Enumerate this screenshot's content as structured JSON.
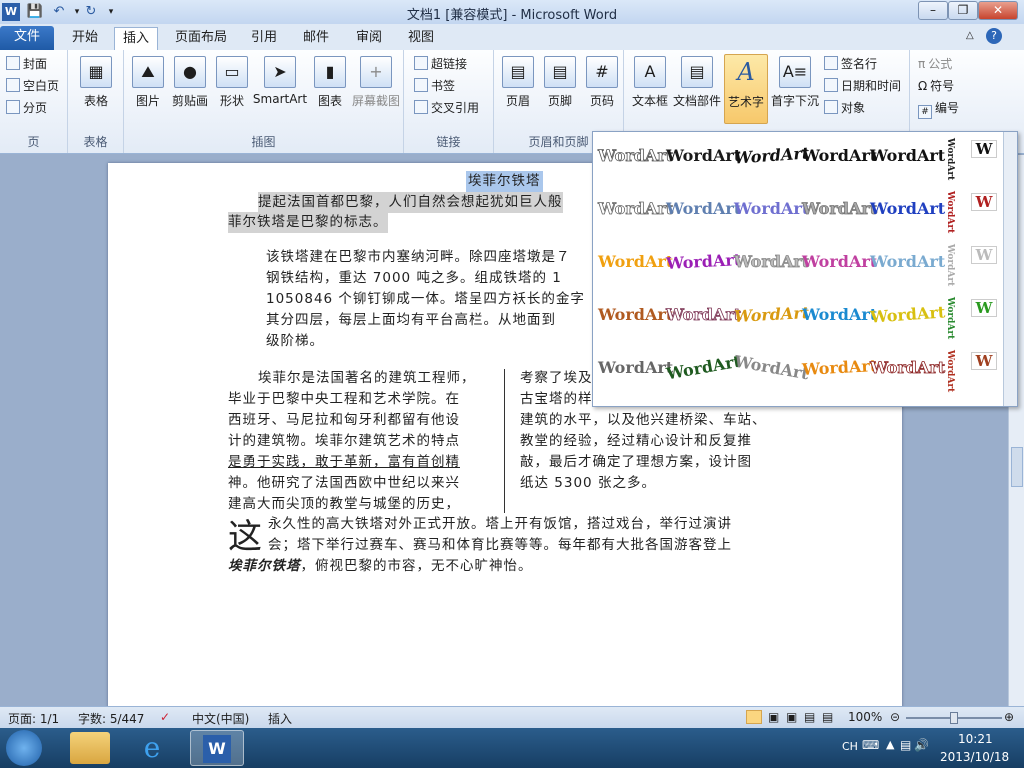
{
  "window": {
    "title": "文档1 [兼容模式] - Microsoft Word"
  },
  "tabs": [
    "文件",
    "开始",
    "插入",
    "页面布局",
    "引用",
    "邮件",
    "审阅",
    "视图"
  ],
  "ribbon": {
    "page": {
      "group": "页",
      "items": [
        "封面",
        "空白页",
        "分页"
      ]
    },
    "table": {
      "group": "表格",
      "label": "表格"
    },
    "illus": {
      "group": "插图",
      "items": [
        "图片",
        "剪贴画",
        "形状",
        "SmartArt",
        "图表",
        "屏幕截图"
      ]
    },
    "links": {
      "group": "链接",
      "items": [
        "超链接",
        "书签",
        "交叉引用"
      ]
    },
    "hf": {
      "group": "页眉和页脚",
      "items": [
        "页眉",
        "页脚",
        "页码"
      ]
    },
    "text": {
      "items": [
        "文本框",
        "文档部件",
        "艺术字",
        "首字下沉"
      ],
      "small": [
        "签名行",
        "日期和时间",
        "对象"
      ]
    },
    "symbols": {
      "items": [
        "公式",
        "符号",
        "编号"
      ]
    }
  },
  "wordart": {
    "sample": "WordArt",
    "vertical": "WordArt"
  },
  "document": {
    "title": "埃菲尔铁塔",
    "para1a": "提起法国首都巴黎，人们自然会想起犹如巨人般",
    "para1b": "菲尔铁塔是巴黎的标志。",
    "para2": [
      "该铁塔建在巴黎市内塞纳河畔。除四座塔墩是７",
      "钢铁结构，重达 7000 吨之多。组成铁塔的 1",
      "1050846 个铆钉铆成一体。塔呈四方袄长的金字",
      "其分四层，每层上面均有平台高栏。从地面到",
      "级阶梯。"
    ],
    "colLeft": [
      "埃菲尔是法国著名的建筑工程师，",
      "毕业于巴黎中央工程和艺术学院。在",
      "西班牙、马尼拉和匈牙利都留有他设",
      "计的建筑物。埃菲尔建筑艺术的特点",
      "是勇于实践，敢于革新，富有首创精",
      "神。他研究了法国西欧中世纪以来兴",
      "建高大而尖顶的教堂与城堡的历史，"
    ],
    "colRight": [
      "考察了埃及",
      "古宝塔的样",
      "建筑的水平，以及他兴建桥梁、车站、",
      "教堂的经验，经过精心设计和反复推",
      "敲，最后才确定了理想方案，设计图",
      "纸达 5300 张之多。"
    ],
    "dropcap": "这",
    "last1": "永久性的高大铁塔对外正式开放。塔上开有饭馆，搭过戏台，举行过演讲",
    "last2": "会；塔下举行过赛车、赛马和体育比赛等等。每年都有大批各国游客登上",
    "last3a": "埃菲尔铁塔",
    "last3b": "，俯视巴黎的市容，无不心旷神怡。"
  },
  "status": {
    "page": "页面: 1/1",
    "words": "字数: 5/447",
    "lang": "中文(中国)",
    "mode": "插入",
    "zoom": "100%"
  },
  "taskbar": {
    "lang": "CH",
    "time": "10:21",
    "date": "2013/10/18"
  }
}
